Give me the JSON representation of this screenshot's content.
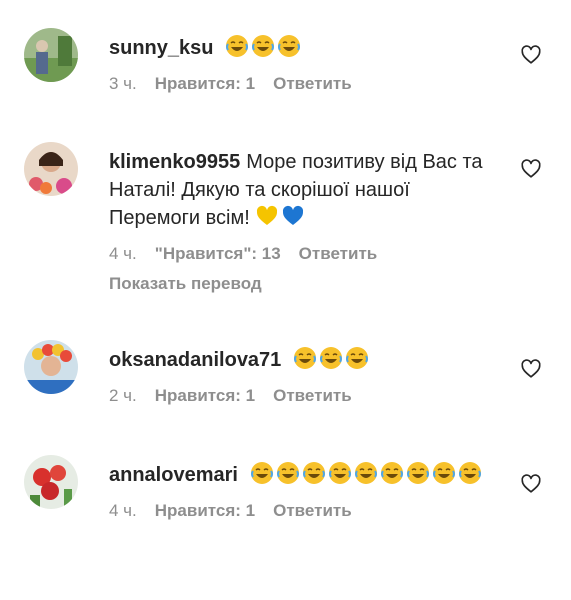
{
  "comments": [
    {
      "username": "sunny_ksu",
      "text": "",
      "emojis": [
        "joy-emoji",
        "joy-emoji",
        "joy-emoji"
      ],
      "time": "3 ч.",
      "likes": "Нравится: 1",
      "reply": "Ответить"
    },
    {
      "username": "klimenko9955",
      "text": "Море позитиву від Вас та Наталі! Дякую та скорішої нашої Перемоги всім!",
      "emojis": [
        "yellow-heart-emoji",
        "blue-heart-emoji"
      ],
      "time": "4 ч.",
      "likes": "\"Нравится\": 13",
      "reply": "Ответить",
      "translate": "Показать перевод"
    },
    {
      "username": "oksanadanilova71",
      "text": "",
      "emojis": [
        "joy-emoji",
        "joy-emoji",
        "joy-emoji"
      ],
      "time": "2 ч.",
      "likes": "Нравится: 1",
      "reply": "Ответить"
    },
    {
      "username": "annalovemari",
      "text": "",
      "emojis": [
        "joy-emoji",
        "joy-emoji",
        "joy-emoji",
        "joy-emoji",
        "joy-emoji",
        "joy-emoji",
        "joy-emoji",
        "joy-emoji",
        "joy-emoji"
      ],
      "time": "4 ч.",
      "likes": "Нравится: 1",
      "reply": "Ответить"
    }
  ],
  "colors": {
    "text": "#262626",
    "muted": "#8e8e8e",
    "emoji_face": "#f7c12b",
    "yellow_heart": "#f5c400",
    "blue_heart": "#1d76d2"
  },
  "icons": {
    "like": "heart-outline-icon"
  }
}
